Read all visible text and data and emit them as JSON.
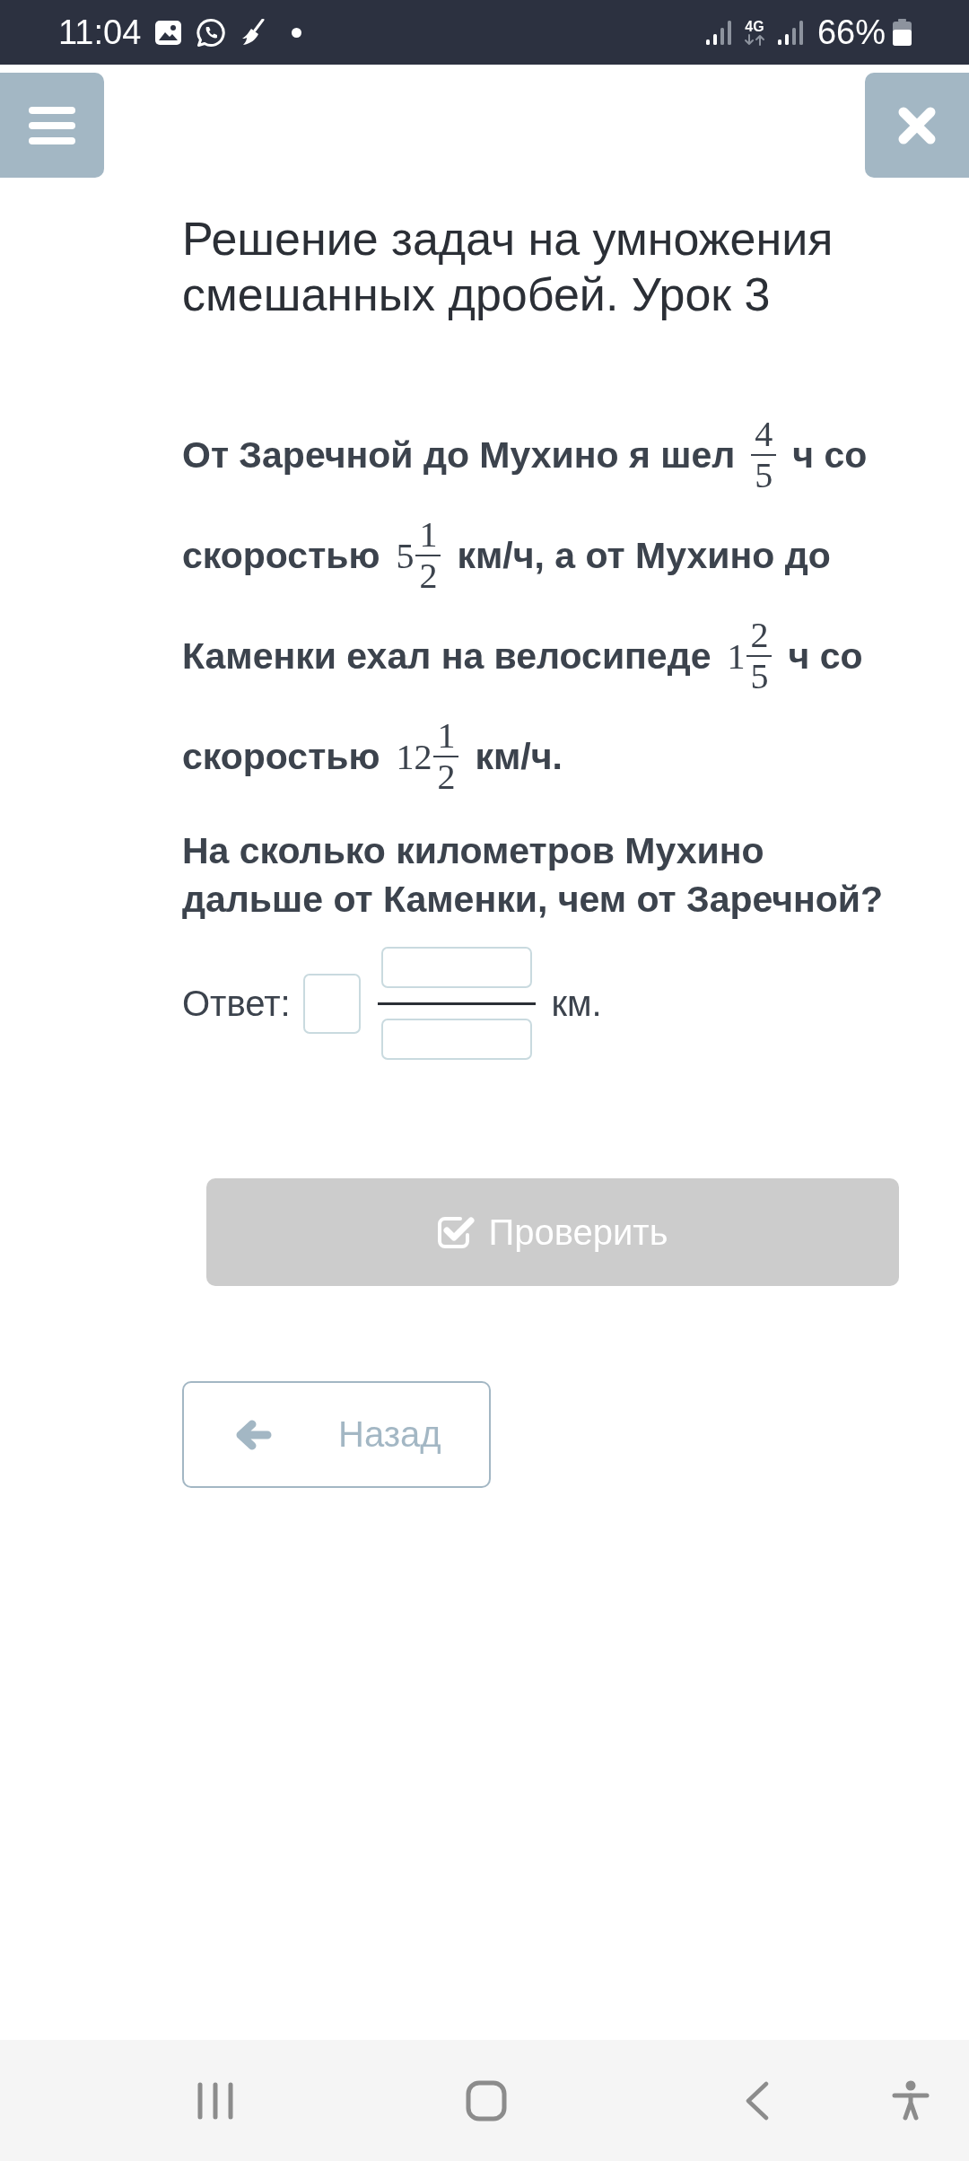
{
  "status_bar": {
    "time": "11:04",
    "network_type": "4G",
    "battery": "66%"
  },
  "title": "Решение задач на умножения смешанных дробей. Урок 3",
  "problem": {
    "lines": [
      [
        {
          "kind": "text",
          "text": "От Заречной до Мухино я шел"
        },
        {
          "kind": "fraction",
          "numerator": "4",
          "denominator": "5"
        },
        {
          "kind": "text",
          "text": "ч со"
        }
      ],
      [
        {
          "kind": "text",
          "text": "скоростью"
        },
        {
          "kind": "fraction",
          "whole": "5",
          "numerator": "1",
          "denominator": "2"
        },
        {
          "kind": "text",
          "text": "км/ч, а от Мухино до"
        }
      ],
      [
        {
          "kind": "text",
          "text": "Каменки ехал на велосипеде"
        },
        {
          "kind": "fraction",
          "whole": "1",
          "numerator": "2",
          "denominator": "5"
        },
        {
          "kind": "text",
          "text": "ч со"
        }
      ],
      [
        {
          "kind": "text",
          "text": "скоростью"
        },
        {
          "kind": "fraction",
          "whole": "12",
          "numerator": "1",
          "denominator": "2"
        },
        {
          "kind": "text",
          "text": "км/ч."
        }
      ]
    ],
    "question": "На сколько километров Мухино дальше от Каменки, чем от Заречной?"
  },
  "answer": {
    "label": "Ответ:",
    "unit": "км."
  },
  "check_button": {
    "label": "Проверить",
    "disabled": true
  },
  "back_button": {
    "label": "Назад"
  }
}
